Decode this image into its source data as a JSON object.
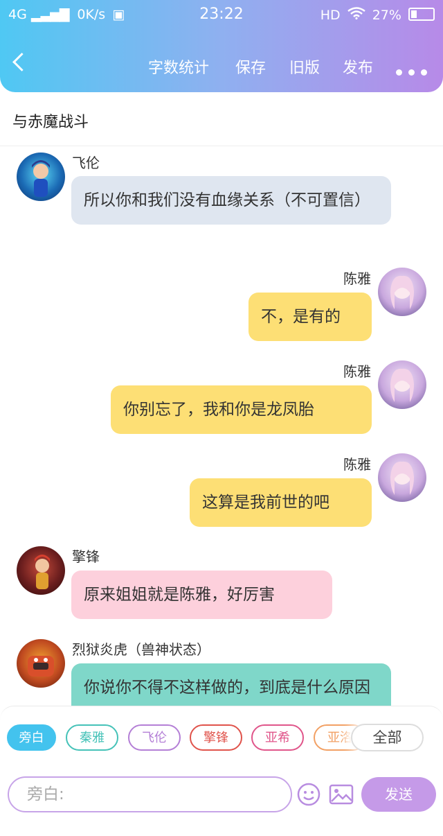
{
  "status_bar": {
    "network": "4G",
    "speed": "0K/s",
    "time": "23:22",
    "hd": "HD",
    "battery": "27%"
  },
  "toolbar": {
    "word_count": "字数统计",
    "save": "保存",
    "old_version": "旧版",
    "publish": "发布"
  },
  "story_title": "与赤魔战斗",
  "messages": [
    {
      "speaker": "飞伦",
      "text": "所以你和我们没有血缘关系（不可置信）",
      "side": "left",
      "color": "#dfe6f0"
    },
    {
      "speaker": "陈雅",
      "text": "不，是有的",
      "side": "right",
      "color": "#fddf75"
    },
    {
      "speaker": "陈雅",
      "text": "你别忘了，我和你是龙凤胎",
      "side": "right",
      "color": "#fddf75"
    },
    {
      "speaker": "陈雅",
      "text": "这算是我前世的吧",
      "side": "right",
      "color": "#fddf75"
    },
    {
      "speaker": "擎锋",
      "text": "原来姐姐就是陈雅，好厉害",
      "side": "left",
      "color": "#fdd0dc"
    },
    {
      "speaker": "烈狱炎虎（兽神状态）",
      "text": "你说你不得不这样做的，到底是什么原因",
      "side": "left",
      "color": "#7fd7c9"
    }
  ],
  "role_chips": [
    {
      "label": "旁白",
      "color": "#43c3ee"
    },
    {
      "label": "秦雅",
      "color": "#45c2b8"
    },
    {
      "label": "飞伦",
      "color": "#b47fd6"
    },
    {
      "label": "擎锋",
      "color": "#e0534b"
    },
    {
      "label": "亚希",
      "color": "#e0558a"
    },
    {
      "label": "亚洛",
      "color": "#f2a064"
    }
  ],
  "all_label": "全部",
  "input": {
    "placeholder": "旁白:"
  },
  "send_label": "发送"
}
